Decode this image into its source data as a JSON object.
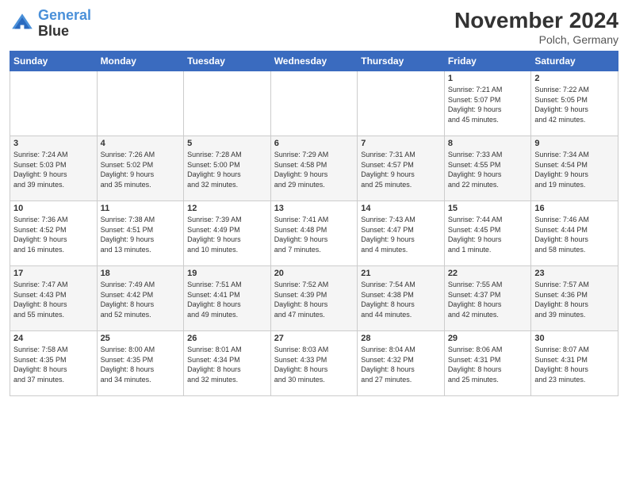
{
  "header": {
    "logo_line1": "General",
    "logo_line2": "Blue",
    "month": "November 2024",
    "location": "Polch, Germany"
  },
  "weekdays": [
    "Sunday",
    "Monday",
    "Tuesday",
    "Wednesday",
    "Thursday",
    "Friday",
    "Saturday"
  ],
  "weeks": [
    [
      {
        "day": "",
        "info": ""
      },
      {
        "day": "",
        "info": ""
      },
      {
        "day": "",
        "info": ""
      },
      {
        "day": "",
        "info": ""
      },
      {
        "day": "",
        "info": ""
      },
      {
        "day": "1",
        "info": "Sunrise: 7:21 AM\nSunset: 5:07 PM\nDaylight: 9 hours\nand 45 minutes."
      },
      {
        "day": "2",
        "info": "Sunrise: 7:22 AM\nSunset: 5:05 PM\nDaylight: 9 hours\nand 42 minutes."
      }
    ],
    [
      {
        "day": "3",
        "info": "Sunrise: 7:24 AM\nSunset: 5:03 PM\nDaylight: 9 hours\nand 39 minutes."
      },
      {
        "day": "4",
        "info": "Sunrise: 7:26 AM\nSunset: 5:02 PM\nDaylight: 9 hours\nand 35 minutes."
      },
      {
        "day": "5",
        "info": "Sunrise: 7:28 AM\nSunset: 5:00 PM\nDaylight: 9 hours\nand 32 minutes."
      },
      {
        "day": "6",
        "info": "Sunrise: 7:29 AM\nSunset: 4:58 PM\nDaylight: 9 hours\nand 29 minutes."
      },
      {
        "day": "7",
        "info": "Sunrise: 7:31 AM\nSunset: 4:57 PM\nDaylight: 9 hours\nand 25 minutes."
      },
      {
        "day": "8",
        "info": "Sunrise: 7:33 AM\nSunset: 4:55 PM\nDaylight: 9 hours\nand 22 minutes."
      },
      {
        "day": "9",
        "info": "Sunrise: 7:34 AM\nSunset: 4:54 PM\nDaylight: 9 hours\nand 19 minutes."
      }
    ],
    [
      {
        "day": "10",
        "info": "Sunrise: 7:36 AM\nSunset: 4:52 PM\nDaylight: 9 hours\nand 16 minutes."
      },
      {
        "day": "11",
        "info": "Sunrise: 7:38 AM\nSunset: 4:51 PM\nDaylight: 9 hours\nand 13 minutes."
      },
      {
        "day": "12",
        "info": "Sunrise: 7:39 AM\nSunset: 4:49 PM\nDaylight: 9 hours\nand 10 minutes."
      },
      {
        "day": "13",
        "info": "Sunrise: 7:41 AM\nSunset: 4:48 PM\nDaylight: 9 hours\nand 7 minutes."
      },
      {
        "day": "14",
        "info": "Sunrise: 7:43 AM\nSunset: 4:47 PM\nDaylight: 9 hours\nand 4 minutes."
      },
      {
        "day": "15",
        "info": "Sunrise: 7:44 AM\nSunset: 4:45 PM\nDaylight: 9 hours\nand 1 minute."
      },
      {
        "day": "16",
        "info": "Sunrise: 7:46 AM\nSunset: 4:44 PM\nDaylight: 8 hours\nand 58 minutes."
      }
    ],
    [
      {
        "day": "17",
        "info": "Sunrise: 7:47 AM\nSunset: 4:43 PM\nDaylight: 8 hours\nand 55 minutes."
      },
      {
        "day": "18",
        "info": "Sunrise: 7:49 AM\nSunset: 4:42 PM\nDaylight: 8 hours\nand 52 minutes."
      },
      {
        "day": "19",
        "info": "Sunrise: 7:51 AM\nSunset: 4:41 PM\nDaylight: 8 hours\nand 49 minutes."
      },
      {
        "day": "20",
        "info": "Sunrise: 7:52 AM\nSunset: 4:39 PM\nDaylight: 8 hours\nand 47 minutes."
      },
      {
        "day": "21",
        "info": "Sunrise: 7:54 AM\nSunset: 4:38 PM\nDaylight: 8 hours\nand 44 minutes."
      },
      {
        "day": "22",
        "info": "Sunrise: 7:55 AM\nSunset: 4:37 PM\nDaylight: 8 hours\nand 42 minutes."
      },
      {
        "day": "23",
        "info": "Sunrise: 7:57 AM\nSunset: 4:36 PM\nDaylight: 8 hours\nand 39 minutes."
      }
    ],
    [
      {
        "day": "24",
        "info": "Sunrise: 7:58 AM\nSunset: 4:35 PM\nDaylight: 8 hours\nand 37 minutes."
      },
      {
        "day": "25",
        "info": "Sunrise: 8:00 AM\nSunset: 4:35 PM\nDaylight: 8 hours\nand 34 minutes."
      },
      {
        "day": "26",
        "info": "Sunrise: 8:01 AM\nSunset: 4:34 PM\nDaylight: 8 hours\nand 32 minutes."
      },
      {
        "day": "27",
        "info": "Sunrise: 8:03 AM\nSunset: 4:33 PM\nDaylight: 8 hours\nand 30 minutes."
      },
      {
        "day": "28",
        "info": "Sunrise: 8:04 AM\nSunset: 4:32 PM\nDaylight: 8 hours\nand 27 minutes."
      },
      {
        "day": "29",
        "info": "Sunrise: 8:06 AM\nSunset: 4:31 PM\nDaylight: 8 hours\nand 25 minutes."
      },
      {
        "day": "30",
        "info": "Sunrise: 8:07 AM\nSunset: 4:31 PM\nDaylight: 8 hours\nand 23 minutes."
      }
    ]
  ]
}
